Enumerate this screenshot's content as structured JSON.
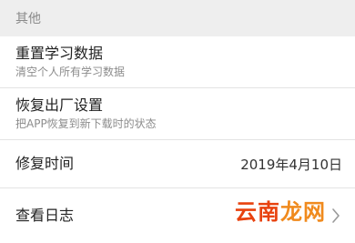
{
  "section": {
    "title": "其他"
  },
  "items": [
    {
      "title": "重置学习数据",
      "subtitle": "清空个人所有学习数据"
    },
    {
      "title": "恢复出厂设置",
      "subtitle": "把APP恢复到新下载时的状态"
    },
    {
      "title": "修复时间",
      "value": "2019年4月10日"
    },
    {
      "title": "查看日志",
      "icon": "chevron-right-icon"
    }
  ],
  "watermark": {
    "part1": "云南",
    "part2": "龙网"
  },
  "colors": {
    "background": "#eeeeee",
    "row": "#ffffff",
    "watermark_primary": "#e8420f",
    "watermark_secondary": "#f08a1d"
  }
}
